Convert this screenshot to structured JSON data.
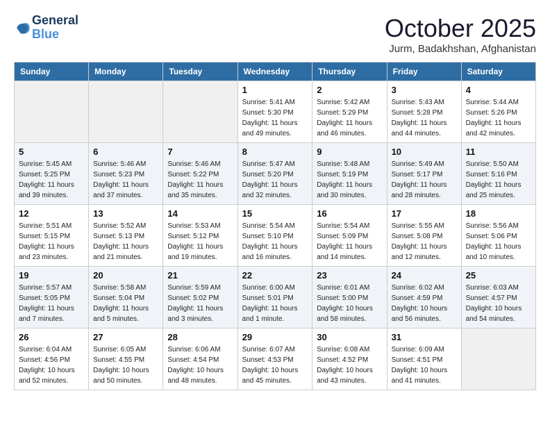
{
  "header": {
    "logo_line1": "General",
    "logo_line2": "Blue",
    "month": "October 2025",
    "location": "Jurm, Badakhshan, Afghanistan"
  },
  "weekdays": [
    "Sunday",
    "Monday",
    "Tuesday",
    "Wednesday",
    "Thursday",
    "Friday",
    "Saturday"
  ],
  "weeks": [
    [
      {
        "day": "",
        "info": ""
      },
      {
        "day": "",
        "info": ""
      },
      {
        "day": "",
        "info": ""
      },
      {
        "day": "1",
        "info": "Sunrise: 5:41 AM\nSunset: 5:30 PM\nDaylight: 11 hours\nand 49 minutes."
      },
      {
        "day": "2",
        "info": "Sunrise: 5:42 AM\nSunset: 5:29 PM\nDaylight: 11 hours\nand 46 minutes."
      },
      {
        "day": "3",
        "info": "Sunrise: 5:43 AM\nSunset: 5:28 PM\nDaylight: 11 hours\nand 44 minutes."
      },
      {
        "day": "4",
        "info": "Sunrise: 5:44 AM\nSunset: 5:26 PM\nDaylight: 11 hours\nand 42 minutes."
      }
    ],
    [
      {
        "day": "5",
        "info": "Sunrise: 5:45 AM\nSunset: 5:25 PM\nDaylight: 11 hours\nand 39 minutes."
      },
      {
        "day": "6",
        "info": "Sunrise: 5:46 AM\nSunset: 5:23 PM\nDaylight: 11 hours\nand 37 minutes."
      },
      {
        "day": "7",
        "info": "Sunrise: 5:46 AM\nSunset: 5:22 PM\nDaylight: 11 hours\nand 35 minutes."
      },
      {
        "day": "8",
        "info": "Sunrise: 5:47 AM\nSunset: 5:20 PM\nDaylight: 11 hours\nand 32 minutes."
      },
      {
        "day": "9",
        "info": "Sunrise: 5:48 AM\nSunset: 5:19 PM\nDaylight: 11 hours\nand 30 minutes."
      },
      {
        "day": "10",
        "info": "Sunrise: 5:49 AM\nSunset: 5:17 PM\nDaylight: 11 hours\nand 28 minutes."
      },
      {
        "day": "11",
        "info": "Sunrise: 5:50 AM\nSunset: 5:16 PM\nDaylight: 11 hours\nand 25 minutes."
      }
    ],
    [
      {
        "day": "12",
        "info": "Sunrise: 5:51 AM\nSunset: 5:15 PM\nDaylight: 11 hours\nand 23 minutes."
      },
      {
        "day": "13",
        "info": "Sunrise: 5:52 AM\nSunset: 5:13 PM\nDaylight: 11 hours\nand 21 minutes."
      },
      {
        "day": "14",
        "info": "Sunrise: 5:53 AM\nSunset: 5:12 PM\nDaylight: 11 hours\nand 19 minutes."
      },
      {
        "day": "15",
        "info": "Sunrise: 5:54 AM\nSunset: 5:10 PM\nDaylight: 11 hours\nand 16 minutes."
      },
      {
        "day": "16",
        "info": "Sunrise: 5:54 AM\nSunset: 5:09 PM\nDaylight: 11 hours\nand 14 minutes."
      },
      {
        "day": "17",
        "info": "Sunrise: 5:55 AM\nSunset: 5:08 PM\nDaylight: 11 hours\nand 12 minutes."
      },
      {
        "day": "18",
        "info": "Sunrise: 5:56 AM\nSunset: 5:06 PM\nDaylight: 11 hours\nand 10 minutes."
      }
    ],
    [
      {
        "day": "19",
        "info": "Sunrise: 5:57 AM\nSunset: 5:05 PM\nDaylight: 11 hours\nand 7 minutes."
      },
      {
        "day": "20",
        "info": "Sunrise: 5:58 AM\nSunset: 5:04 PM\nDaylight: 11 hours\nand 5 minutes."
      },
      {
        "day": "21",
        "info": "Sunrise: 5:59 AM\nSunset: 5:02 PM\nDaylight: 11 hours\nand 3 minutes."
      },
      {
        "day": "22",
        "info": "Sunrise: 6:00 AM\nSunset: 5:01 PM\nDaylight: 11 hours\nand 1 minute."
      },
      {
        "day": "23",
        "info": "Sunrise: 6:01 AM\nSunset: 5:00 PM\nDaylight: 10 hours\nand 58 minutes."
      },
      {
        "day": "24",
        "info": "Sunrise: 6:02 AM\nSunset: 4:59 PM\nDaylight: 10 hours\nand 56 minutes."
      },
      {
        "day": "25",
        "info": "Sunrise: 6:03 AM\nSunset: 4:57 PM\nDaylight: 10 hours\nand 54 minutes."
      }
    ],
    [
      {
        "day": "26",
        "info": "Sunrise: 6:04 AM\nSunset: 4:56 PM\nDaylight: 10 hours\nand 52 minutes."
      },
      {
        "day": "27",
        "info": "Sunrise: 6:05 AM\nSunset: 4:55 PM\nDaylight: 10 hours\nand 50 minutes."
      },
      {
        "day": "28",
        "info": "Sunrise: 6:06 AM\nSunset: 4:54 PM\nDaylight: 10 hours\nand 48 minutes."
      },
      {
        "day": "29",
        "info": "Sunrise: 6:07 AM\nSunset: 4:53 PM\nDaylight: 10 hours\nand 45 minutes."
      },
      {
        "day": "30",
        "info": "Sunrise: 6:08 AM\nSunset: 4:52 PM\nDaylight: 10 hours\nand 43 minutes."
      },
      {
        "day": "31",
        "info": "Sunrise: 6:09 AM\nSunset: 4:51 PM\nDaylight: 10 hours\nand 41 minutes."
      },
      {
        "day": "",
        "info": ""
      }
    ]
  ]
}
